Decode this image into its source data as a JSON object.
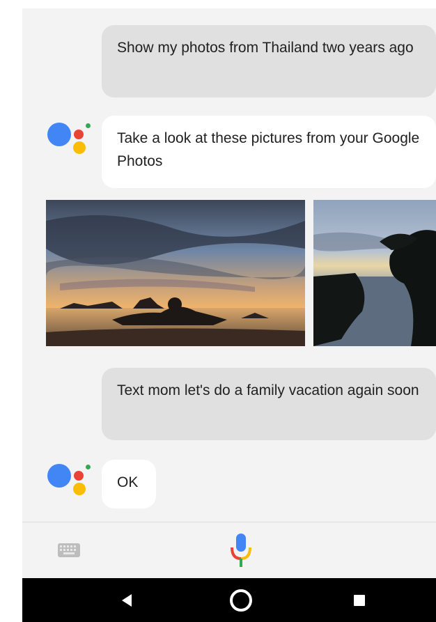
{
  "conversation": {
    "messages": [
      {
        "role": "user",
        "text": "Show my photos from Thailand two years ago"
      },
      {
        "role": "assistant",
        "text": "Take a look at these pictures from your Google Photos"
      },
      {
        "role": "user",
        "text": "Text mom let's do a family vacation again soon"
      },
      {
        "role": "assistant",
        "text": "OK"
      }
    ]
  },
  "photos": {
    "items": [
      {
        "name": "sunset-islands-photo"
      },
      {
        "name": "sunset-trees-photo"
      }
    ]
  },
  "input_bar": {
    "keyboard_icon": "keyboard-icon",
    "mic_icon": "microphone-icon"
  },
  "nav_bar": {
    "back_icon": "back-triangle-icon",
    "home_icon": "home-circle-icon",
    "recents_icon": "recents-square-icon"
  },
  "colors": {
    "background": "#f3f3f3",
    "user_bubble": "#e0e0e0",
    "assistant_bubble": "#ffffff",
    "google_blue": "#4285f4",
    "google_red": "#ea4335",
    "google_yellow": "#fbbc05",
    "google_green": "#34a853",
    "nav_bar": "#000000"
  }
}
